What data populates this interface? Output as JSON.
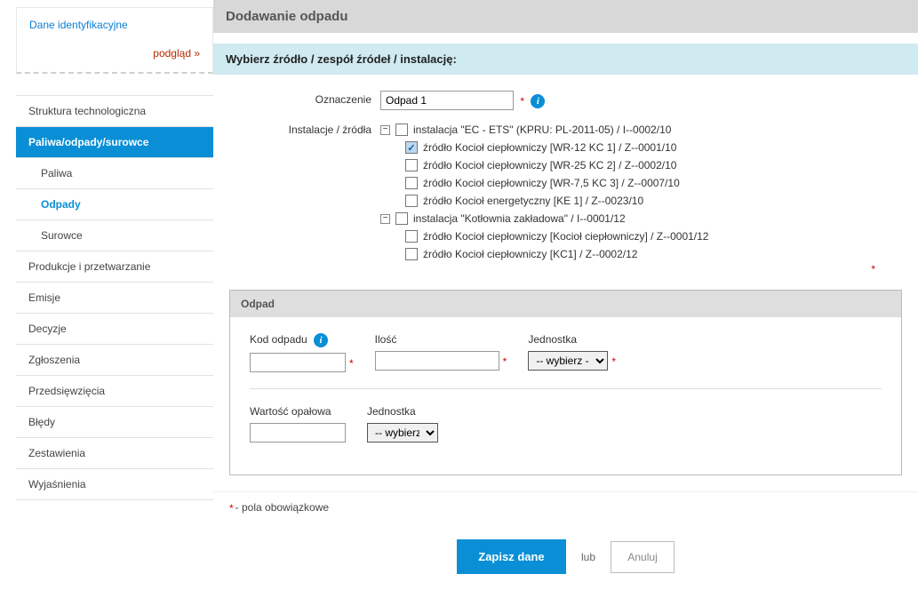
{
  "sidebar": {
    "ident_link": "Dane identyfikacyjne",
    "preview_link": "podgląd »",
    "items": [
      {
        "label": "Struktura technologiczna",
        "type": "item"
      },
      {
        "label": "Paliwa/odpady/surowce",
        "type": "active"
      },
      {
        "label": "Paliwa",
        "type": "sub"
      },
      {
        "label": "Odpady",
        "type": "sub-active"
      },
      {
        "label": "Surowce",
        "type": "sub"
      },
      {
        "label": "Produkcje i przetwarzanie",
        "type": "item"
      },
      {
        "label": "Emisje",
        "type": "item"
      },
      {
        "label": "Decyzje",
        "type": "item"
      },
      {
        "label": "Zgłoszenia",
        "type": "item"
      },
      {
        "label": "Przedsięwzięcia",
        "type": "item"
      },
      {
        "label": "Błędy",
        "type": "item"
      },
      {
        "label": "Zestawienia",
        "type": "item"
      },
      {
        "label": "Wyjaśnienia",
        "type": "item"
      }
    ]
  },
  "header": {
    "title": "Dodawanie odpadu",
    "subtitle": "Wybierz źródło / zespół źródeł / instalację:"
  },
  "form": {
    "oznaczenie_label": "Oznaczenie",
    "oznaczenie_value": "Odpad 1",
    "instalacje_label": "Instalacje / źródła",
    "tree": [
      {
        "label": "instalacja \"EC - ETS\" (KPRU: PL-2011-05) / I--0002/10",
        "level": 0,
        "expand": "-",
        "checked": false
      },
      {
        "label": "źródło Kocioł ciepłowniczy [WR-12 KC 1] / Z--0001/10",
        "level": 1,
        "checked": true
      },
      {
        "label": "źródło Kocioł ciepłowniczy [WR-25 KC 2] / Z--0002/10",
        "level": 1,
        "checked": false
      },
      {
        "label": "źródło Kocioł ciepłowniczy [WR-7,5 KC 3] / Z--0007/10",
        "level": 1,
        "checked": false
      },
      {
        "label": "źródło Kocioł energetyczny [KE 1] / Z--0023/10",
        "level": 1,
        "checked": false
      },
      {
        "label": "instalacja \"Kotłownia zakładowa\" / I--0001/12",
        "level": 0,
        "expand": "-",
        "checked": false
      },
      {
        "label": "źródło Kocioł ciepłowniczy [Kocioł ciepłowniczy] / Z--0001/12",
        "level": 1,
        "checked": false
      },
      {
        "label": "źródło Kocioł ciepłowniczy [KC1] / Z--0002/12",
        "level": 1,
        "checked": false
      }
    ]
  },
  "odpad": {
    "panel_title": "Odpad",
    "kod_label": "Kod odpadu",
    "ilosc_label": "Ilość",
    "jednostka_label": "Jednostka",
    "jednostka_placeholder": "-- wybierz --",
    "wart_label": "Wartość opałowa",
    "jednostka2_label": "Jednostka",
    "jednostka2_placeholder": "-- wybierz --"
  },
  "note": "- pola obowiązkowe",
  "actions": {
    "save": "Zapisz dane",
    "or": "lub",
    "cancel": "Anuluj"
  }
}
